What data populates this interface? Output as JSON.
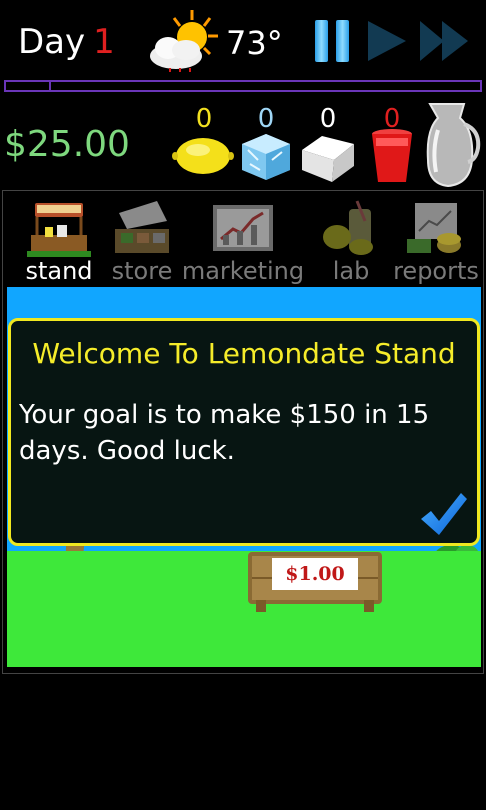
{
  "header": {
    "day_label": "Day",
    "day_number": "1",
    "weather_icon": "partly-cloudy-sun-icon",
    "temperature": "73°",
    "controls": [
      "pause",
      "play",
      "fast-forward"
    ],
    "day_progress_fraction": 0.09
  },
  "inventory": {
    "money": "$25.00",
    "lemons": "0",
    "ice": "0",
    "sugar": "0",
    "cups": "0",
    "colors": {
      "lemons": "#f2e020",
      "ice": "#9fd6f5",
      "sugar": "#ffffff",
      "cups": "#e02020"
    }
  },
  "tabs": [
    {
      "label": "stand",
      "icon": "stand-icon",
      "active": true
    },
    {
      "label": "store",
      "icon": "store-icon",
      "active": false
    },
    {
      "label": "marketing",
      "icon": "marketing-chart-icon",
      "active": false
    },
    {
      "label": "lab",
      "icon": "lemonade-lab-icon",
      "active": false
    },
    {
      "label": "reports",
      "icon": "reports-icon",
      "active": false
    }
  ],
  "dialog": {
    "title": "Welcome To Lemondate Stand",
    "message": "Your goal is to make $150 in 15 days. Good luck.",
    "confirm_icon": "checkmark-icon"
  },
  "scene": {
    "price": "$1.00"
  }
}
